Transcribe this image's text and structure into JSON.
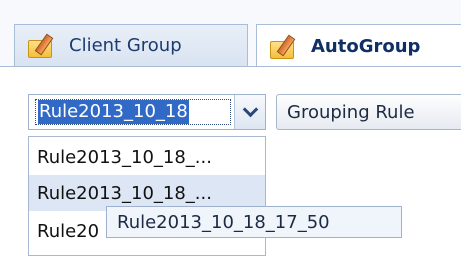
{
  "tabs": {
    "client_group": "Client Group",
    "autogroup": "AutoGroup"
  },
  "rule_combo": {
    "value": "Rule2013_10_18",
    "icon": "chevron-down-icon"
  },
  "grouping_button": {
    "label": "Grouping Rule"
  },
  "dropdown_items": [
    {
      "label": "Rule2013_10_18_..."
    },
    {
      "label": "Rule2013_10_18_..."
    },
    {
      "label": "Rule20"
    }
  ],
  "tooltip": {
    "text": "Rule2013_10_18_17_50"
  },
  "colors": {
    "accent_selection": "#3169c6",
    "hover_row": "#dce6f4",
    "border": "#a9bdd8"
  }
}
